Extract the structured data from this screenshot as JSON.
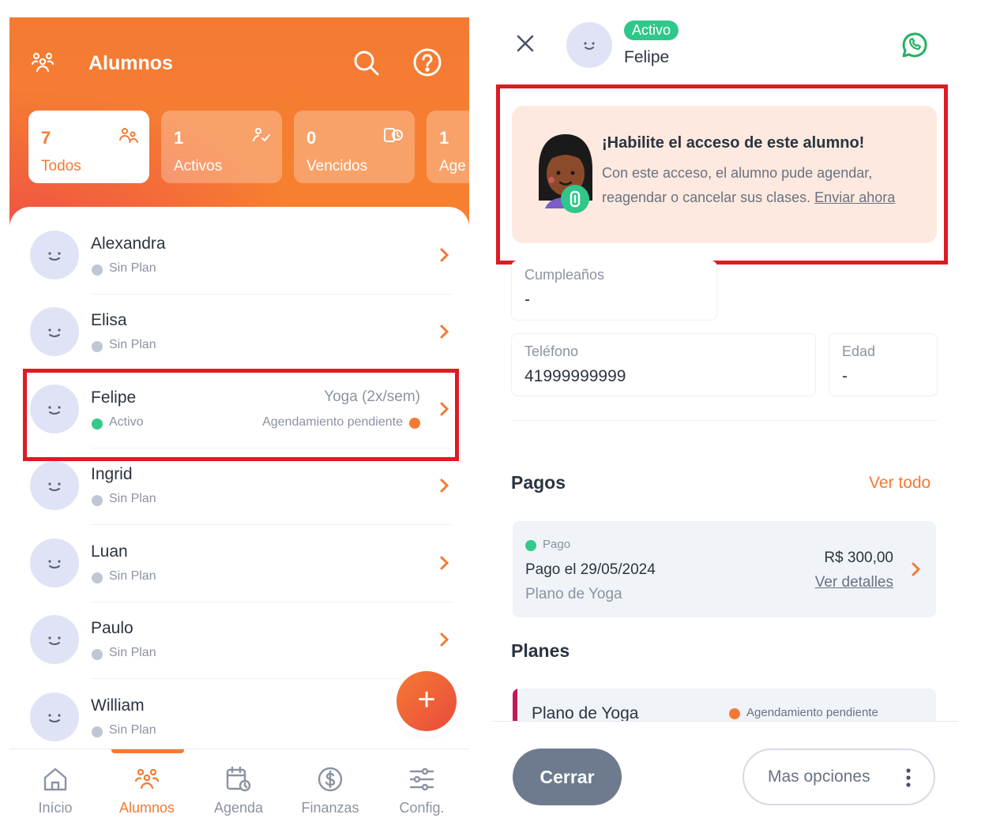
{
  "left_panel": {
    "header": {
      "title": "Alumnos",
      "accent": "#f47a33"
    },
    "stats": [
      {
        "count": "7",
        "label": "Todos",
        "icon": "users-icon"
      },
      {
        "count": "1",
        "label": "Activos",
        "icon": "user-check-icon"
      },
      {
        "count": "0",
        "label": "Vencidos",
        "icon": "expired-card-icon"
      },
      {
        "count": "1",
        "label": "Age",
        "icon": "calendar-icon"
      }
    ],
    "students": [
      {
        "name": "Alexandra",
        "status": "Sin Plan"
      },
      {
        "name": "Elisa",
        "status": "Sin Plan"
      },
      {
        "name": "Felipe",
        "status": "Activo",
        "plan": "Yoga (2x/sem)",
        "pending": "Agendamiento pendiente"
      },
      {
        "name": "Ingrid",
        "status": "Sin Plan"
      },
      {
        "name": "Luan",
        "status": "Sin Plan"
      },
      {
        "name": "Paulo",
        "status": "Sin Plan"
      },
      {
        "name": "William",
        "status": "Sin Plan"
      }
    ],
    "fab_label": "+",
    "nav": [
      {
        "label": "Início",
        "icon": "home-icon"
      },
      {
        "label": "Alumnos",
        "icon": "users-icon"
      },
      {
        "label": "Agenda",
        "icon": "calendar-clock-icon"
      },
      {
        "label": "Finanzas",
        "icon": "dollar-icon"
      },
      {
        "label": "Config.",
        "icon": "sliders-icon"
      }
    ]
  },
  "right_panel": {
    "student": {
      "name": "Felipe",
      "badge": "Activo"
    },
    "promo": {
      "title": "¡Habilite el acceso de este alumno!",
      "text": "Con este acceso, el alumno pude agendar, reagendar o cancelar sus clases.",
      "link": "Enviar ahora"
    },
    "fields": {
      "birthday": {
        "label": "Cumpleaños",
        "value": "-"
      },
      "phone": {
        "label": "Teléfono",
        "value": "41999999999"
      },
      "age": {
        "label": "Edad",
        "value": "-"
      }
    },
    "payments": {
      "title": "Pagos",
      "see_all": "Ver todo",
      "item": {
        "status": "Pago",
        "line1": "Pago el 29/05/2024",
        "line2": "Plano de Yoga",
        "amount": "R$ 300,00",
        "details": "Ver detalles"
      }
    },
    "plans": {
      "title": "Planes",
      "item": {
        "name": "Plano de Yoga",
        "status": "Agendamiento pendiente"
      }
    },
    "buttons": {
      "close": "Cerrar",
      "more": "Mas opciones"
    }
  }
}
